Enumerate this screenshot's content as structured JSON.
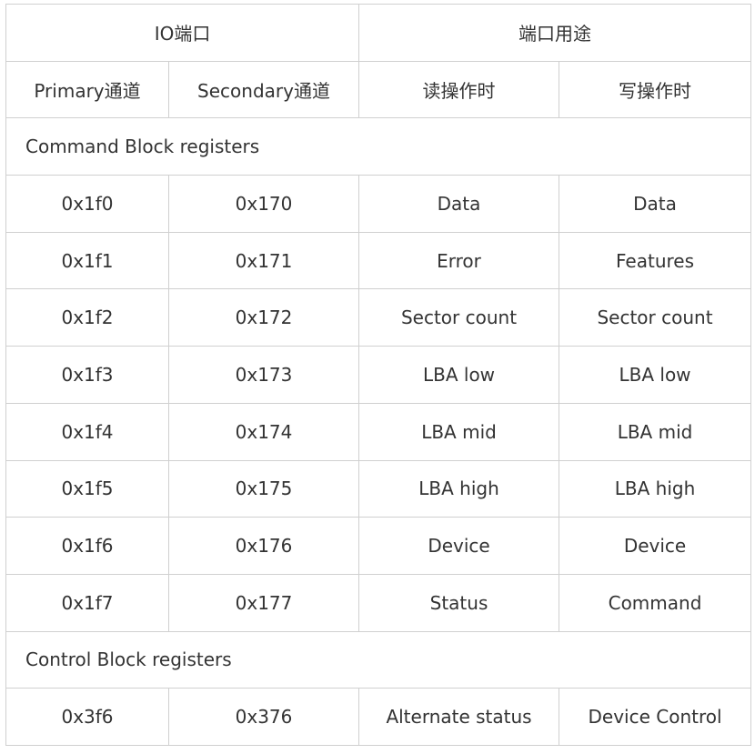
{
  "table": {
    "header_top": {
      "io_port": "IO端口",
      "port_usage": "端口用途"
    },
    "header_sub": {
      "primary": "Primary通道",
      "secondary": "Secondary通道",
      "read": "读操作时",
      "write": "写操作时"
    },
    "command_section": {
      "title": "Command Block registers",
      "rows": [
        {
          "primary": "0x1f0",
          "secondary": "0x170",
          "read": "Data",
          "write": "Data"
        },
        {
          "primary": "0x1f1",
          "secondary": "0x171",
          "read": "Error",
          "write": "Features"
        },
        {
          "primary": "0x1f2",
          "secondary": "0x172",
          "read": "Sector count",
          "write": "Sector count"
        },
        {
          "primary": "0x1f3",
          "secondary": "0x173",
          "read": "LBA low",
          "write": "LBA low"
        },
        {
          "primary": "0x1f4",
          "secondary": "0x174",
          "read": "LBA mid",
          "write": "LBA mid"
        },
        {
          "primary": "0x1f5",
          "secondary": "0x175",
          "read": "LBA high",
          "write": "LBA high"
        },
        {
          "primary": "0x1f6",
          "secondary": "0x176",
          "read": "Device",
          "write": "Device"
        },
        {
          "primary": "0x1f7",
          "secondary": "0x177",
          "read": "Status",
          "write": "Command"
        }
      ]
    },
    "control_section": {
      "title": "Control Block registers",
      "rows": [
        {
          "primary": "0x3f6",
          "secondary": "0x376",
          "read": "Alternate status",
          "write": "Device Control"
        }
      ]
    }
  }
}
